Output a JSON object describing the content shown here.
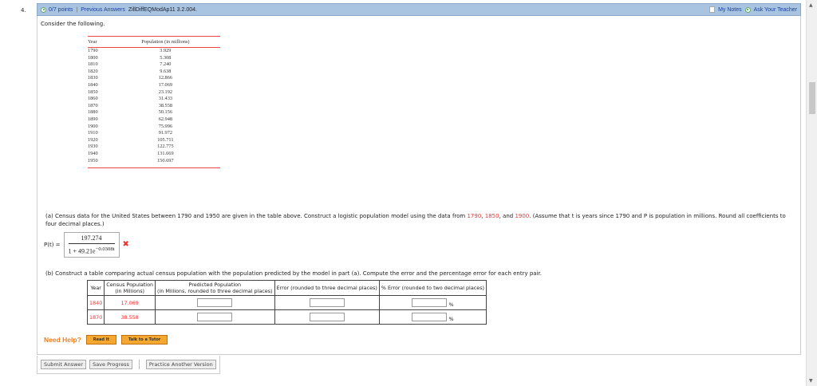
{
  "question": {
    "number": "4.",
    "points": "0/7 points",
    "separator": "|",
    "prev": "Previous Answers",
    "code": "ZillDiffEQModAp11 3.2.004.",
    "my_notes": "My Notes",
    "ask_teacher": "Ask Your Teacher"
  },
  "intro": "Consider the following.",
  "data_table": {
    "headers": [
      "Year",
      "Population (in millions)"
    ],
    "rows": [
      [
        "1790",
        "3.929"
      ],
      [
        "1800",
        "5.308"
      ],
      [
        "1810",
        "7.240"
      ],
      [
        "1820",
        "9.638"
      ],
      [
        "1830",
        "12.866"
      ],
      [
        "1840",
        "17.069"
      ],
      [
        "1850",
        "23.192"
      ],
      [
        "1860",
        "31.433"
      ],
      [
        "1870",
        "38.558"
      ],
      [
        "1880",
        "50.156"
      ],
      [
        "1890",
        "62.948"
      ],
      [
        "1900",
        "75.996"
      ],
      [
        "1910",
        "91.972"
      ],
      [
        "1920",
        "105.711"
      ],
      [
        "1930",
        "122.775"
      ],
      [
        "1940",
        "131.669"
      ],
      [
        "1950",
        "150.697"
      ]
    ]
  },
  "part_a": {
    "text1": "(a) Census data for the United States between 1790 and 1950 are given in the table above. Construct a logistic population model using the data from ",
    "y1": "1790",
    "c1": ", ",
    "y2": "1850",
    "c2": ", and ",
    "y3": "1900",
    "text2": ". (Assume that t is years since 1790 and P is population in millions. Round all coefficients to four decimal places.)",
    "label": "P(t) =",
    "numerator": "197.274",
    "denominator": "1 + 49.21e",
    "exponent": "−0.0308t",
    "status": "✖"
  },
  "part_b": {
    "text": "(b) Construct a table comparing actual census population with the population predicted by the model in part (a). Compute the error and the percentage error for each entry pair.",
    "headers": [
      "Year",
      "Census Population",
      "(in Millions)",
      "Predicted Population",
      "(in Millions, rounded to three decimal places)",
      "Error (rounded to three decimal places)",
      "% Error (rounded to two decimal places)"
    ],
    "rows": [
      {
        "year": "1840",
        "census": "17.069",
        "pct": "%"
      },
      {
        "year": "1870",
        "census": "38.558",
        "pct": "%"
      }
    ]
  },
  "help": {
    "label": "Need Help?",
    "read": "Read It",
    "tutor": "Talk to a Tutor"
  },
  "footer": {
    "submit": "Submit Answer",
    "save": "Save Progress",
    "practice": "Practice Another Version"
  }
}
